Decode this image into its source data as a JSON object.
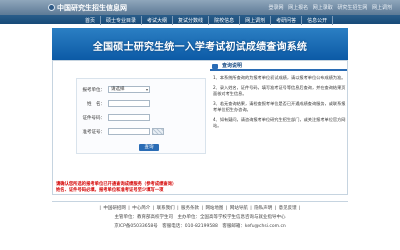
{
  "header": {
    "site_title": "中国研究生招生信息网",
    "top_links": [
      "登录网",
      "网上报名",
      "网上录取",
      "研究生招生网",
      "网上调剂"
    ]
  },
  "nav": {
    "items": [
      "首页",
      "硕士专业目录",
      "考试大纲",
      "复试分数线",
      "院校信息",
      "网上调剂",
      "考研问答",
      "信息公开"
    ]
  },
  "banner": {
    "title": "全国硕士研究生统一入学考试初试成绩查询系统"
  },
  "login": {
    "fields": [
      {
        "label": "报考单位：",
        "value": "请选择",
        "type": "select"
      },
      {
        "label": "姓　名：",
        "value": "",
        "type": "text"
      },
      {
        "label": "证件号码：",
        "value": "",
        "type": "text"
      },
      {
        "label": "准考证号：",
        "value": "",
        "type": "text"
      }
    ],
    "submit_label": "查询"
  },
  "notice": {
    "line1": "请确认您所选的报考单位已开通查询成绩服务（参考成绩查询）",
    "line2": "姓名、证件号码必填，报考单位和准考证号至少填写一项"
  },
  "info_panel": {
    "title": "查询说明",
    "items": [
      "1、本系统所查询的为报考单位初试成绩，请以报考单位公布成绩为准。",
      "2、录入姓名，证件号码，填写准考证号等信息后查询，并在查询结果页面核对考生信息。",
      "3、若无查询结果，请检查报考单位是否已开通成绩查询服务，或联系报考单位招生办咨询。",
      "4、如有疑问，请咨询报考单位研究生招生部门，或关注报考单位官方网站。"
    ]
  },
  "footer": {
    "links": [
      "中国研招网",
      "中心简介",
      "联系我们",
      "服务条款",
      "网站地图",
      "网站导航",
      "隐私声明",
      "意见反馈"
    ],
    "line1": "主管单位：教育部高校学生司　主办单位：全国高等学校学生信息咨询与就业指导中心",
    "line2": "京ICP备05033658号　客服电话：010-82199588　客服邮箱：kefu@chsi.com.cn"
  }
}
